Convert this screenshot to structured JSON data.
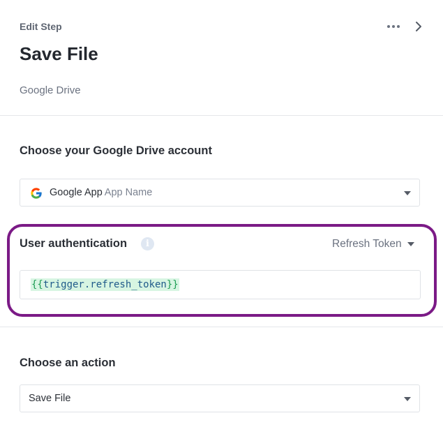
{
  "header": {
    "eyebrow": "Edit Step",
    "title": "Save File",
    "subtitle": "Google Drive",
    "more_icon": "more-horizontal-icon",
    "next_icon": "chevron-right-icon"
  },
  "account": {
    "label": "Choose your Google Drive account",
    "selected_app": "Google App",
    "selected_name": "App Name",
    "icon": "google-logo-icon"
  },
  "auth": {
    "label": "User authentication",
    "info_icon": "info-icon",
    "mode": "Refresh Token",
    "value": "{{trigger.refresh_token}}",
    "value_parts": {
      "open": "{{",
      "inner": "trigger.refresh_token",
      "close": "}}"
    },
    "highlight_color": "#7b1a86"
  },
  "action": {
    "label": "Choose an action",
    "selected": "Save File"
  }
}
